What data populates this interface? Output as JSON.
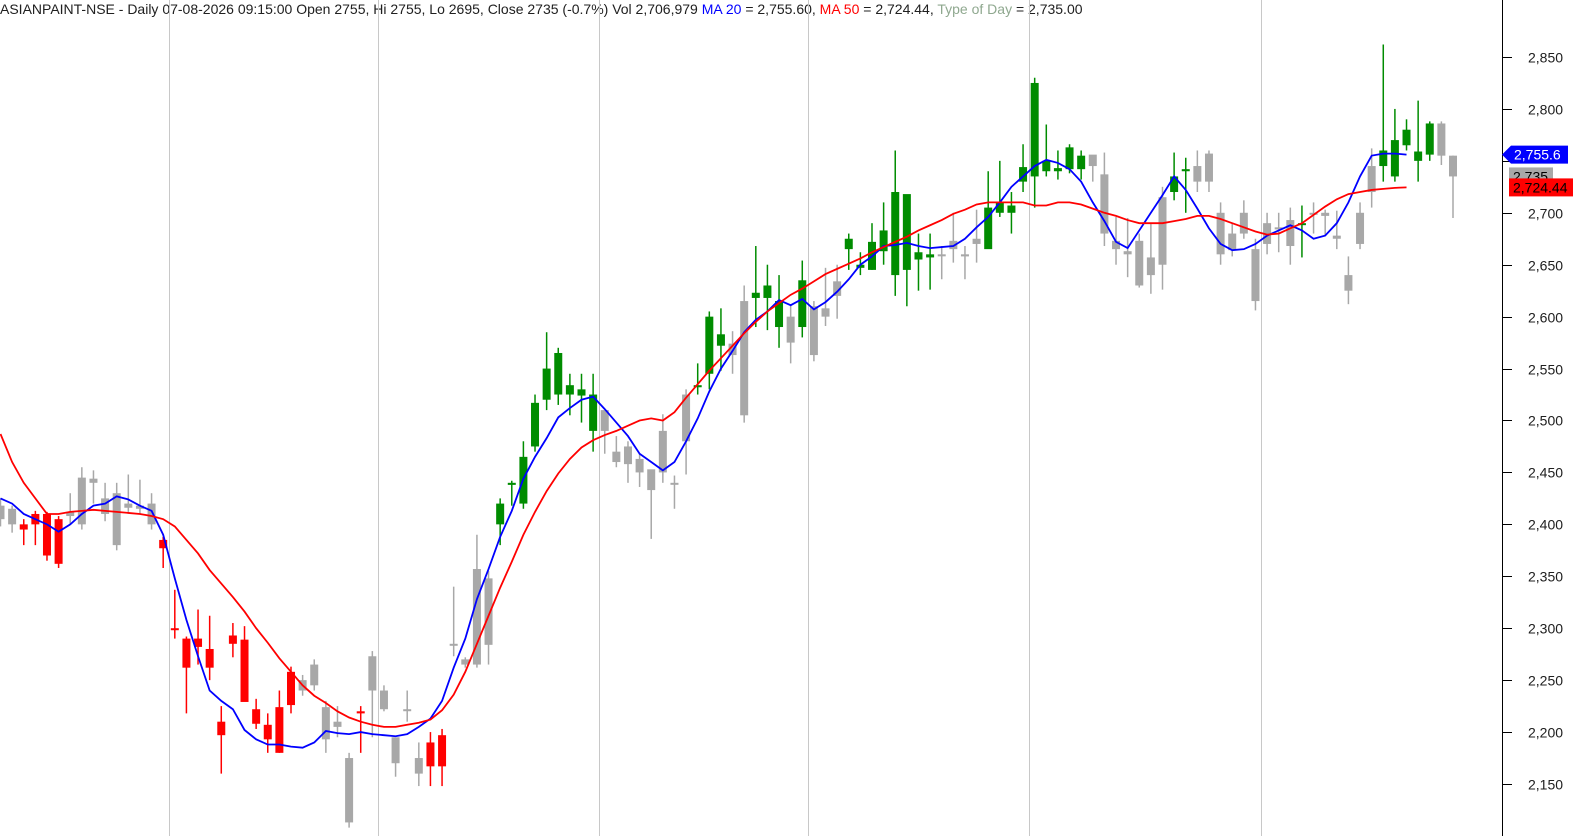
{
  "header": {
    "symbol_info": "ASIANPAINT-NSE - Daily 07-08-2026 09:15:00 Open 2755, Hi 2755, Lo 2695, Close 2735 (-0.7%) Vol 2,706,979 ",
    "ma20_label": "MA 20",
    "ma20_value": " = 2,755.60, ",
    "ma50_label": "MA 50",
    "ma50_value": " = 2,724.44, ",
    "tod_label": "Type of Day",
    "tod_value": " = 2,735.00"
  },
  "badges": {
    "ma20": "2,755.6",
    "close": "2,735",
    "ma50": "2,724.44"
  },
  "colors": {
    "up": "#008c00",
    "down": "#ff0000",
    "neutral": "#a8a8a8",
    "ma20": "#0000ff",
    "ma50": "#ff0000",
    "tod": "#8fa88f",
    "grid": "#c8c8c8"
  },
  "chart_data": {
    "type": "candlestick",
    "ylim": [
      2108,
      2906
    ],
    "y_ticks": [
      2150,
      2200,
      2250,
      2300,
      2350,
      2400,
      2450,
      2500,
      2550,
      2600,
      2650,
      2700,
      2750,
      2800,
      2850
    ],
    "y_tick_labels": [
      "2,150",
      "2,200",
      "2,250",
      "2,300",
      "2,350",
      "2,400",
      "2,450",
      "2,500",
      "2,550",
      "2,600",
      "2,650",
      "2,700",
      "",
      "2,800",
      "2,850"
    ],
    "bar_count": 116,
    "vertical_grid_bars": [
      14.5,
      32.5,
      51.5,
      69.5,
      88.5,
      108.5
    ],
    "candles": [
      {
        "o": 2418,
        "h": 2425,
        "l": 2398,
        "c": 2405,
        "t": "n"
      },
      {
        "o": 2415,
        "h": 2418,
        "l": 2392,
        "c": 2400,
        "t": "n"
      },
      {
        "o": 2400,
        "h": 2405,
        "l": 2380,
        "c": 2395,
        "t": "d"
      },
      {
        "o": 2410,
        "h": 2413,
        "l": 2380,
        "c": 2400,
        "t": "d"
      },
      {
        "o": 2410,
        "h": 2412,
        "l": 2365,
        "c": 2370,
        "t": "d"
      },
      {
        "o": 2405,
        "h": 2408,
        "l": 2358,
        "c": 2362,
        "t": "d"
      },
      {
        "o": 2408,
        "h": 2430,
        "l": 2400,
        "c": 2412,
        "t": "n"
      },
      {
        "o": 2400,
        "h": 2455,
        "l": 2395,
        "c": 2445,
        "t": "n"
      },
      {
        "o": 2440,
        "h": 2452,
        "l": 2420,
        "c": 2444,
        "t": "n"
      },
      {
        "o": 2410,
        "h": 2440,
        "l": 2403,
        "c": 2425,
        "t": "n"
      },
      {
        "o": 2430,
        "h": 2440,
        "l": 2375,
        "c": 2380,
        "t": "n"
      },
      {
        "o": 2420,
        "h": 2448,
        "l": 2412,
        "c": 2416,
        "t": "n"
      },
      {
        "o": 2418,
        "h": 2443,
        "l": 2410,
        "c": 2415,
        "t": "n"
      },
      {
        "o": 2420,
        "h": 2430,
        "l": 2395,
        "c": 2400,
        "t": "n"
      },
      {
        "o": 2385,
        "h": 2388,
        "l": 2358,
        "c": 2377,
        "t": "d"
      },
      {
        "o": 2300,
        "h": 2337,
        "l": 2290,
        "c": 2300,
        "t": "d"
      },
      {
        "o": 2290,
        "h": 2292,
        "l": 2218,
        "c": 2262,
        "t": "d"
      },
      {
        "o": 2290,
        "h": 2318,
        "l": 2265,
        "c": 2282,
        "t": "d"
      },
      {
        "o": 2280,
        "h": 2312,
        "l": 2250,
        "c": 2262,
        "t": "d"
      },
      {
        "o": 2210,
        "h": 2225,
        "l": 2160,
        "c": 2197,
        "t": "d"
      },
      {
        "o": 2293,
        "h": 2305,
        "l": 2272,
        "c": 2285,
        "t": "d"
      },
      {
        "o": 2289,
        "h": 2302,
        "l": 2230,
        "c": 2229,
        "t": "d"
      },
      {
        "o": 2222,
        "h": 2232,
        "l": 2203,
        "c": 2208,
        "t": "d"
      },
      {
        "o": 2207,
        "h": 2218,
        "l": 2180,
        "c": 2193,
        "t": "d"
      },
      {
        "o": 2224,
        "h": 2240,
        "l": 2180,
        "c": 2180,
        "t": "d"
      },
      {
        "o": 2258,
        "h": 2263,
        "l": 2218,
        "c": 2226,
        "t": "d"
      },
      {
        "o": 2250,
        "h": 2255,
        "l": 2235,
        "c": 2240,
        "t": "n"
      },
      {
        "o": 2245,
        "h": 2270,
        "l": 2240,
        "c": 2265,
        "t": "n"
      },
      {
        "o": 2224,
        "h": 2230,
        "l": 2180,
        "c": 2193,
        "t": "n"
      },
      {
        "o": 2210,
        "h": 2225,
        "l": 2195,
        "c": 2205,
        "t": "n"
      },
      {
        "o": 2175,
        "h": 2180,
        "l": 2108,
        "c": 2113,
        "t": "n"
      },
      {
        "o": 2220,
        "h": 2225,
        "l": 2180,
        "c": 2218,
        "t": "d"
      },
      {
        "o": 2240,
        "h": 2278,
        "l": 2195,
        "c": 2273,
        "t": "n"
      },
      {
        "o": 2240,
        "h": 2245,
        "l": 2220,
        "c": 2222,
        "t": "n"
      },
      {
        "o": 2170,
        "h": 2180,
        "l": 2157,
        "c": 2195,
        "t": "n"
      },
      {
        "o": 2222,
        "h": 2240,
        "l": 2210,
        "c": 2222,
        "t": "n"
      },
      {
        "o": 2160,
        "h": 2190,
        "l": 2148,
        "c": 2175,
        "t": "n"
      },
      {
        "o": 2190,
        "h": 2200,
        "l": 2148,
        "c": 2167,
        "t": "d"
      },
      {
        "o": 2197,
        "h": 2203,
        "l": 2148,
        "c": 2167,
        "t": "d"
      },
      {
        "o": 2285,
        "h": 2340,
        "l": 2273,
        "c": 2285,
        "t": "n"
      },
      {
        "o": 2265,
        "h": 2272,
        "l": 2262,
        "c": 2270,
        "t": "n"
      },
      {
        "o": 2265,
        "h": 2390,
        "l": 2262,
        "c": 2357,
        "t": "n"
      },
      {
        "o": 2284,
        "h": 2355,
        "l": 2265,
        "c": 2348,
        "t": "n"
      },
      {
        "o": 2400,
        "h": 2425,
        "l": 2380,
        "c": 2420,
        "t": "u"
      },
      {
        "o": 2438,
        "h": 2442,
        "l": 2418,
        "c": 2440,
        "t": "u"
      },
      {
        "o": 2420,
        "h": 2480,
        "l": 2415,
        "c": 2465,
        "t": "u"
      },
      {
        "o": 2475,
        "h": 2525,
        "l": 2470,
        "c": 2517,
        "t": "u"
      },
      {
        "o": 2520,
        "h": 2585,
        "l": 2510,
        "c": 2550,
        "t": "u"
      },
      {
        "o": 2525,
        "h": 2570,
        "l": 2515,
        "c": 2565,
        "t": "u"
      },
      {
        "o": 2525,
        "h": 2545,
        "l": 2505,
        "c": 2534,
        "t": "u"
      },
      {
        "o": 2530,
        "h": 2545,
        "l": 2498,
        "c": 2524,
        "t": "u"
      },
      {
        "o": 2525,
        "h": 2545,
        "l": 2470,
        "c": 2490,
        "t": "u"
      },
      {
        "o": 2490,
        "h": 2495,
        "l": 2468,
        "c": 2510,
        "t": "n"
      },
      {
        "o": 2460,
        "h": 2485,
        "l": 2455,
        "c": 2470,
        "t": "n"
      },
      {
        "o": 2475,
        "h": 2480,
        "l": 2440,
        "c": 2458,
        "t": "n"
      },
      {
        "o": 2450,
        "h": 2468,
        "l": 2436,
        "c": 2463,
        "t": "n"
      },
      {
        "o": 2433,
        "h": 2447,
        "l": 2386,
        "c": 2453,
        "t": "n"
      },
      {
        "o": 2450,
        "h": 2506,
        "l": 2440,
        "c": 2490,
        "t": "n"
      },
      {
        "o": 2440,
        "h": 2447,
        "l": 2415,
        "c": 2440,
        "t": "n"
      },
      {
        "o": 2525,
        "h": 2530,
        "l": 2448,
        "c": 2480,
        "t": "n"
      },
      {
        "o": 2532,
        "h": 2555,
        "l": 2525,
        "c": 2534,
        "t": "u"
      },
      {
        "o": 2545,
        "h": 2605,
        "l": 2530,
        "c": 2600,
        "t": "u"
      },
      {
        "o": 2583,
        "h": 2608,
        "l": 2548,
        "c": 2572,
        "t": "u"
      },
      {
        "o": 2563,
        "h": 2586,
        "l": 2545,
        "c": 2574,
        "t": "n"
      },
      {
        "o": 2505,
        "h": 2630,
        "l": 2498,
        "c": 2615,
        "t": "n"
      },
      {
        "o": 2623,
        "h": 2668,
        "l": 2590,
        "c": 2618,
        "t": "u"
      },
      {
        "o": 2630,
        "h": 2650,
        "l": 2587,
        "c": 2618,
        "t": "u"
      },
      {
        "o": 2590,
        "h": 2640,
        "l": 2570,
        "c": 2615,
        "t": "u"
      },
      {
        "o": 2600,
        "h": 2612,
        "l": 2555,
        "c": 2575,
        "t": "n"
      },
      {
        "o": 2590,
        "h": 2654,
        "l": 2580,
        "c": 2635,
        "t": "u"
      },
      {
        "o": 2563,
        "h": 2615,
        "l": 2557,
        "c": 2610,
        "t": "n"
      },
      {
        "o": 2600,
        "h": 2647,
        "l": 2591,
        "c": 2608,
        "t": "n"
      },
      {
        "o": 2620,
        "h": 2650,
        "l": 2598,
        "c": 2634,
        "t": "n"
      },
      {
        "o": 2665,
        "h": 2680,
        "l": 2645,
        "c": 2675,
        "t": "u"
      },
      {
        "o": 2650,
        "h": 2662,
        "l": 2640,
        "c": 2647,
        "t": "u"
      },
      {
        "o": 2645,
        "h": 2690,
        "l": 2645,
        "c": 2672,
        "t": "u"
      },
      {
        "o": 2663,
        "h": 2710,
        "l": 2650,
        "c": 2683,
        "t": "u"
      },
      {
        "o": 2720,
        "h": 2760,
        "l": 2620,
        "c": 2640,
        "t": "u"
      },
      {
        "o": 2645,
        "h": 2675,
        "l": 2610,
        "c": 2718,
        "t": "u"
      },
      {
        "o": 2662,
        "h": 2680,
        "l": 2625,
        "c": 2655,
        "t": "u"
      },
      {
        "o": 2657,
        "h": 2680,
        "l": 2626,
        "c": 2660,
        "t": "u"
      },
      {
        "o": 2660,
        "h": 2668,
        "l": 2636,
        "c": 2660,
        "t": "n"
      },
      {
        "o": 2665,
        "h": 2700,
        "l": 2652,
        "c": 2673,
        "t": "n"
      },
      {
        "o": 2660,
        "h": 2668,
        "l": 2636,
        "c": 2658,
        "t": "n"
      },
      {
        "o": 2675,
        "h": 2703,
        "l": 2652,
        "c": 2670,
        "t": "n"
      },
      {
        "o": 2705,
        "h": 2740,
        "l": 2670,
        "c": 2665,
        "t": "u"
      },
      {
        "o": 2700,
        "h": 2750,
        "l": 2696,
        "c": 2710,
        "t": "u"
      },
      {
        "o": 2700,
        "h": 2720,
        "l": 2680,
        "c": 2707,
        "t": "u"
      },
      {
        "o": 2744,
        "h": 2766,
        "l": 2720,
        "c": 2730,
        "t": "u"
      },
      {
        "o": 2735,
        "h": 2830,
        "l": 2705,
        "c": 2825,
        "t": "u"
      },
      {
        "o": 2740,
        "h": 2785,
        "l": 2735,
        "c": 2750,
        "t": "u"
      },
      {
        "o": 2740,
        "h": 2760,
        "l": 2732,
        "c": 2743,
        "t": "u"
      },
      {
        "o": 2763,
        "h": 2766,
        "l": 2738,
        "c": 2742,
        "t": "u"
      },
      {
        "o": 2742,
        "h": 2760,
        "l": 2732,
        "c": 2755,
        "t": "u"
      },
      {
        "o": 2745,
        "h": 2755,
        "l": 2730,
        "c": 2756,
        "t": "n"
      },
      {
        "o": 2680,
        "h": 2758,
        "l": 2668,
        "c": 2737,
        "t": "n"
      },
      {
        "o": 2673,
        "h": 2696,
        "l": 2650,
        "c": 2665,
        "t": "n"
      },
      {
        "o": 2660,
        "h": 2695,
        "l": 2638,
        "c": 2663,
        "t": "n"
      },
      {
        "o": 2630,
        "h": 2680,
        "l": 2628,
        "c": 2673,
        "t": "n"
      },
      {
        "o": 2640,
        "h": 2690,
        "l": 2622,
        "c": 2657,
        "t": "n"
      },
      {
        "o": 2650,
        "h": 2725,
        "l": 2626,
        "c": 2715,
        "t": "n"
      },
      {
        "o": 2720,
        "h": 2758,
        "l": 2712,
        "c": 2735,
        "t": "u"
      },
      {
        "o": 2740,
        "h": 2753,
        "l": 2700,
        "c": 2742,
        "t": "u"
      },
      {
        "o": 2745,
        "h": 2760,
        "l": 2720,
        "c": 2730,
        "t": "n"
      },
      {
        "o": 2730,
        "h": 2760,
        "l": 2720,
        "c": 2757,
        "t": "n"
      },
      {
        "o": 2700,
        "h": 2710,
        "l": 2650,
        "c": 2660,
        "t": "n"
      },
      {
        "o": 2680,
        "h": 2690,
        "l": 2658,
        "c": 2664,
        "t": "n"
      },
      {
        "o": 2700,
        "h": 2712,
        "l": 2675,
        "c": 2680,
        "t": "n"
      },
      {
        "o": 2665,
        "h": 2675,
        "l": 2606,
        "c": 2615,
        "t": "n"
      },
      {
        "o": 2670,
        "h": 2700,
        "l": 2660,
        "c": 2690,
        "t": "n"
      },
      {
        "o": 2686,
        "h": 2700,
        "l": 2662,
        "c": 2684,
        "t": "n"
      },
      {
        "o": 2668,
        "h": 2705,
        "l": 2650,
        "c": 2693,
        "t": "n"
      },
      {
        "o": 2690,
        "h": 2707,
        "l": 2657,
        "c": 2690,
        "t": "u"
      },
      {
        "o": 2700,
        "h": 2710,
        "l": 2680,
        "c": 2699,
        "t": "n"
      },
      {
        "o": 2700,
        "h": 2703,
        "l": 2678,
        "c": 2697,
        "t": "n"
      },
      {
        "o": 2675,
        "h": 2702,
        "l": 2665,
        "c": 2678,
        "t": "n"
      },
      {
        "o": 2640,
        "h": 2658,
        "l": 2612,
        "c": 2625,
        "t": "n"
      },
      {
        "o": 2670,
        "h": 2710,
        "l": 2665,
        "c": 2700,
        "t": "n"
      },
      {
        "o": 2720,
        "h": 2762,
        "l": 2705,
        "c": 2745,
        "t": "n"
      },
      {
        "o": 2745,
        "h": 2862,
        "l": 2730,
        "c": 2760,
        "t": "u"
      },
      {
        "o": 2735,
        "h": 2800,
        "l": 2730,
        "c": 2770,
        "t": "u"
      },
      {
        "o": 2780,
        "h": 2790,
        "l": 2760,
        "c": 2765,
        "t": "u"
      },
      {
        "o": 2750,
        "h": 2808,
        "l": 2730,
        "c": 2759,
        "t": "u"
      },
      {
        "o": 2756,
        "h": 2788,
        "l": 2750,
        "c": 2786,
        "t": "u"
      },
      {
        "o": 2755,
        "h": 2788,
        "l": 2746,
        "c": 2786,
        "t": "n"
      },
      {
        "o": 2755,
        "h": 2755,
        "l": 2695,
        "c": 2735,
        "t": "n"
      }
    ],
    "series": [
      {
        "name": "MA 20",
        "values": [
          2425,
          2420,
          2410,
          2405,
          2400,
          2393,
          2400,
          2410,
          2418,
          2420,
          2427,
          2424,
          2418,
          2413,
          2390,
          2348,
          2308,
          2273,
          2240,
          2230,
          2222,
          2202,
          2193,
          2188,
          2188,
          2186,
          2185,
          2190,
          2201,
          2199,
          2198,
          2200,
          2198,
          2197,
          2196,
          2198,
          2205,
          2213,
          2230,
          2262,
          2290,
          2328,
          2357,
          2388,
          2413,
          2444,
          2465,
          2483,
          2503,
          2512,
          2520,
          2523,
          2511,
          2498,
          2485,
          2468,
          2460,
          2452,
          2460,
          2480,
          2502,
          2528,
          2550,
          2567,
          2585,
          2597,
          2605,
          2616,
          2611,
          2617,
          2607,
          2614,
          2624,
          2636,
          2650,
          2658,
          2668,
          2669,
          2671,
          2668,
          2666,
          2667,
          2668,
          2675,
          2686,
          2696,
          2710,
          2725,
          2735,
          2745,
          2751,
          2748,
          2742,
          2730,
          2710,
          2692,
          2672,
          2666,
          2683,
          2700,
          2717,
          2735,
          2722,
          2704,
          2685,
          2670,
          2664,
          2665,
          2670,
          2678,
          2683,
          2688,
          2683,
          2675,
          2678,
          2690,
          2710,
          2735,
          2755,
          2757,
          2757,
          2756
        ]
      },
      {
        "name": "MA 50",
        "values": [
          2487,
          2460,
          2440,
          2425,
          2410,
          2410,
          2412,
          2413,
          2414,
          2413,
          2412,
          2411,
          2410,
          2408,
          2405,
          2398,
          2385,
          2372,
          2356,
          2343,
          2330,
          2316,
          2300,
          2286,
          2271,
          2258,
          2245,
          2235,
          2228,
          2220,
          2214,
          2210,
          2207,
          2205,
          2205,
          2207,
          2209,
          2212,
          2221,
          2236,
          2258,
          2285,
          2312,
          2339,
          2364,
          2390,
          2412,
          2432,
          2449,
          2463,
          2474,
          2481,
          2486,
          2490,
          2495,
          2500,
          2502,
          2500,
          2508,
          2522,
          2535,
          2548,
          2560,
          2572,
          2584,
          2595,
          2605,
          2613,
          2621,
          2627,
          2634,
          2641,
          2646,
          2651,
          2656,
          2662,
          2667,
          2672,
          2677,
          2683,
          2688,
          2693,
          2699,
          2703,
          2708,
          2710,
          2710,
          2710,
          2710,
          2707,
          2707,
          2710,
          2710,
          2708,
          2704,
          2700,
          2697,
          2693,
          2690,
          2690,
          2690,
          2692,
          2694,
          2697,
          2697,
          2694,
          2690,
          2686,
          2682,
          2679,
          2680,
          2685,
          2690,
          2698,
          2706,
          2713,
          2718,
          2720,
          2722,
          2723,
          2724,
          2724.44
        ]
      }
    ]
  }
}
